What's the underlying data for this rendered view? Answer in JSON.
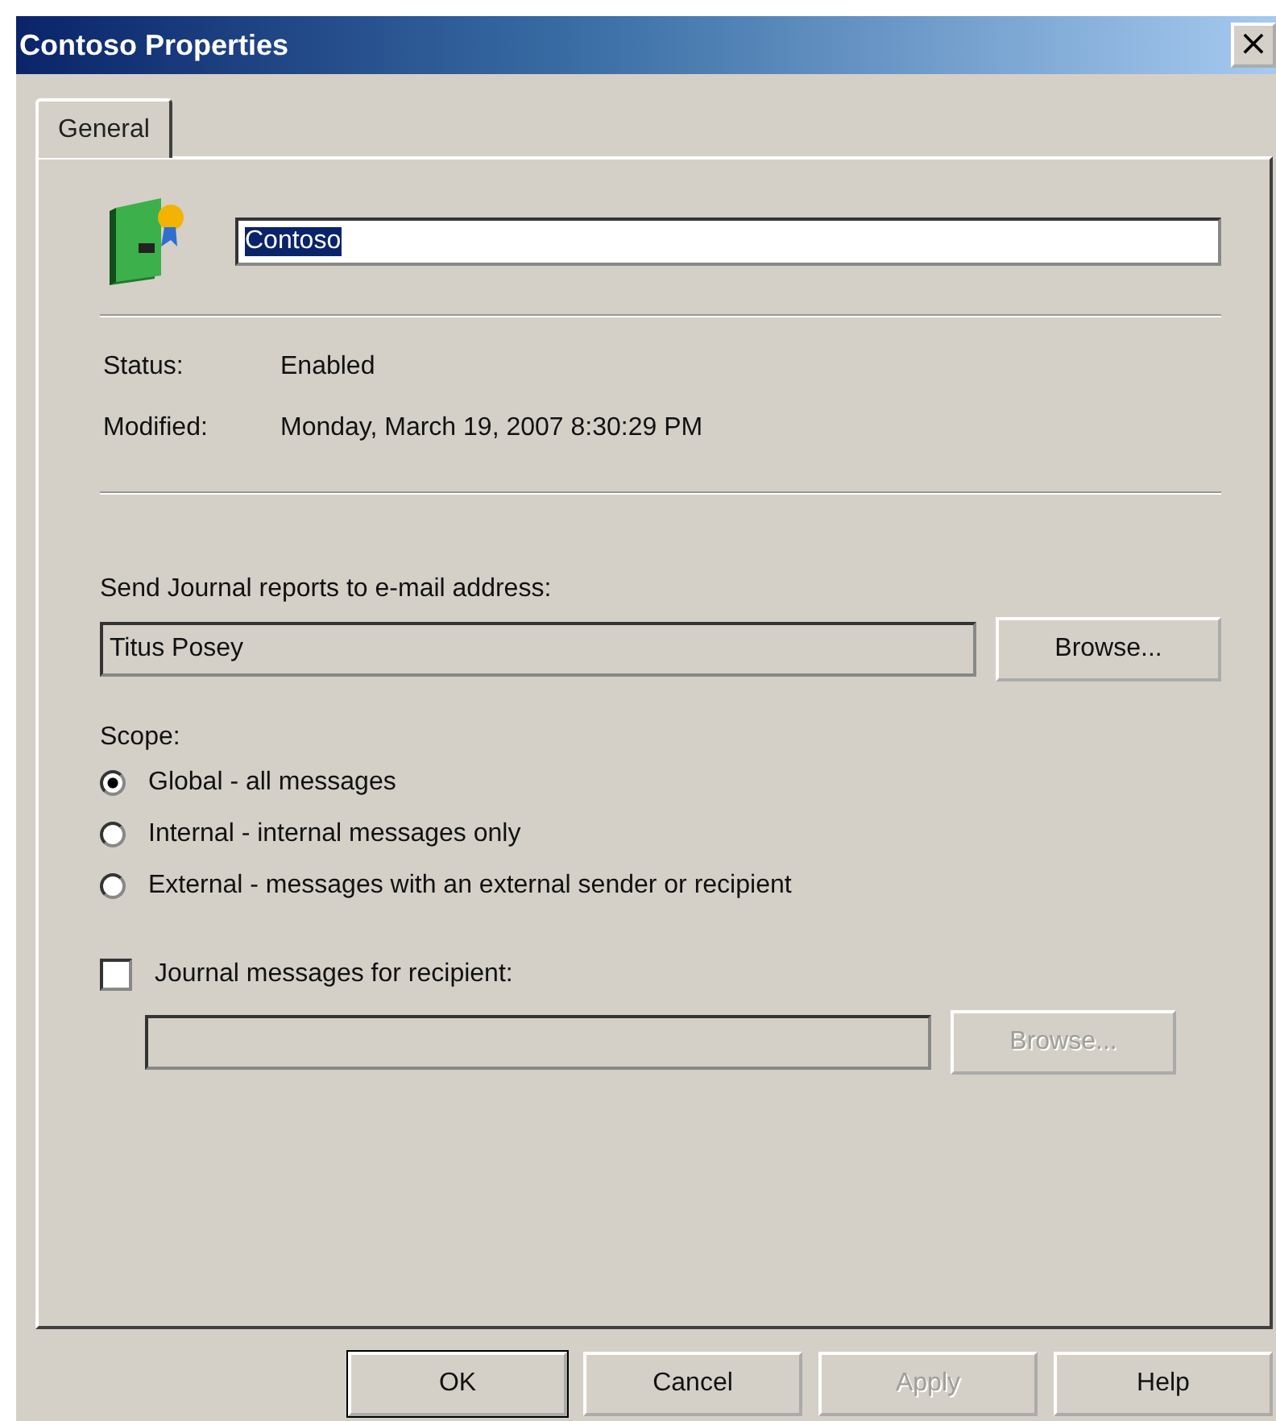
{
  "window": {
    "title": "Contoso Properties",
    "close": "×"
  },
  "tabs": [
    {
      "label": "General",
      "selected": true
    }
  ],
  "name_field": {
    "value": "Contoso",
    "selected_text": true
  },
  "info": [
    {
      "label": "Status:",
      "value": "Enabled"
    },
    {
      "label": "Modified:",
      "value": "Monday, March 19, 2007 8:30:29 PM"
    }
  ],
  "journal_address": {
    "label": "Send Journal reports to e-mail address:",
    "value": "Titus Posey",
    "button": {
      "label": "Browse...",
      "disabled": false
    }
  },
  "scope": {
    "label": "Scope:",
    "options": [
      {
        "label": "Global - all messages",
        "selected": true
      },
      {
        "label": "Internal - internal messages only",
        "selected": false
      },
      {
        "label": "External - messages with an external sender or recipient",
        "selected": false
      }
    ]
  },
  "recipient": {
    "label": "Journal messages for recipient:",
    "checked": false,
    "field_disabled": true,
    "button": {
      "label": "Browse...",
      "disabled": true
    }
  },
  "buttons": [
    {
      "label": "OK",
      "disabled": false,
      "default": true
    },
    {
      "label": "Cancel",
      "disabled": false,
      "default": false
    },
    {
      "label": "Apply",
      "disabled": true,
      "default": false
    },
    {
      "label": "Help",
      "disabled": false,
      "default": false
    }
  ]
}
